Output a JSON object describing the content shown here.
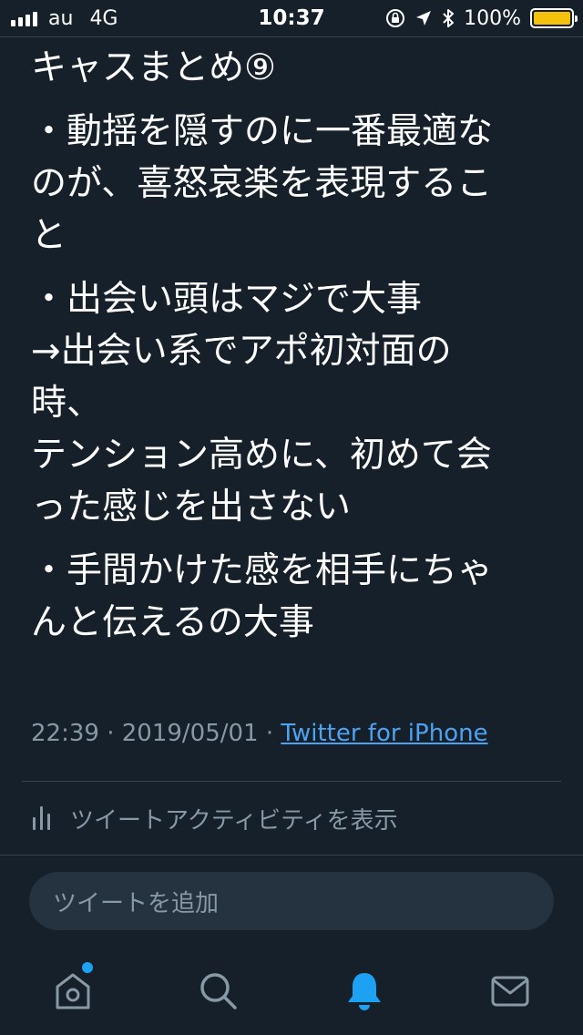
{
  "status_bar": {
    "carrier": "au",
    "network": "4G",
    "time": "10:37",
    "battery_percent": "100%",
    "battery_level": 1.0,
    "battery_color": "#f4c20d"
  },
  "tweet": {
    "paragraphs": [
      {
        "lines": [
          "キャスまとめ⑨"
        ]
      },
      {
        "lines": [
          "・動揺を隠すのに一番最適な",
          "のが、喜怒哀楽を表現するこ",
          "と"
        ]
      },
      {
        "lines": [
          "・出会い頭はマジで大事",
          "→出会い系でアポ初対面の",
          "時、",
          "テンション高めに、初めて会",
          "った感じを出さない"
        ]
      },
      {
        "lines": [
          "・手間かけた感を相手にちゃ",
          "んと伝えるの大事"
        ]
      }
    ],
    "time": "22:39",
    "separator": "·",
    "date": "2019/05/01",
    "source": "Twitter for iPhone"
  },
  "activity": {
    "label": "ツイートアクティビティを表示",
    "icon": "bar-chart-icon"
  },
  "reply": {
    "placeholder": "ツイートを追加"
  },
  "tab_bar": {
    "tabs": [
      {
        "name": "home",
        "icon": "home-icon",
        "active": false,
        "has_notification_dot": true
      },
      {
        "name": "search",
        "icon": "search-icon",
        "active": false
      },
      {
        "name": "notifications",
        "icon": "bell-icon",
        "active": true
      },
      {
        "name": "messages",
        "icon": "mail-icon",
        "active": false
      }
    ],
    "active_color": "#1da1f2",
    "inactive_color": "#8899a6"
  },
  "colors": {
    "background": "#15202b",
    "text": "#ffffff",
    "secondary_text": "#8899a6",
    "link": "#4da3f0",
    "divider": "#38444d"
  }
}
